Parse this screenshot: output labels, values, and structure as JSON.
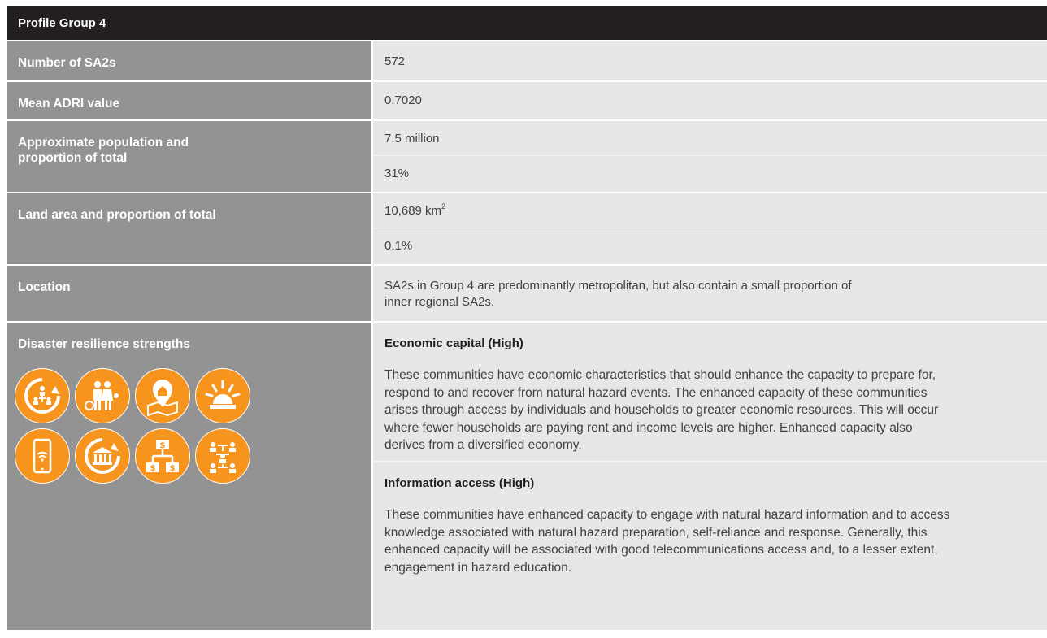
{
  "header": {
    "title": "Profile Group 4"
  },
  "rows": {
    "sa2": {
      "label": "Number of SA2s",
      "value": "572"
    },
    "adri": {
      "label": "Mean ADRI value",
      "value": "0.7020"
    },
    "population": {
      "label": "Approximate population and proportion of total",
      "value1": "7.5 million",
      "value2": "31%"
    },
    "land": {
      "label": "Land area and proportion of total",
      "value1": "10,689 km",
      "value1_sup": "2",
      "value2": "0.1%"
    },
    "location": {
      "label": "Location",
      "value": "SA2s in Group 4 are predominantly metropolitan, but also contain a small proportion of inner regional SA2s."
    },
    "strengths": {
      "label": "Disaster resilience strengths",
      "icons": [
        "social-network-cycle-icon",
        "family-group-icon",
        "home-location-map-icon",
        "warning-light-icon",
        "mobile-phone-wifi-icon",
        "institution-cycle-icon",
        "money-flow-chart-icon",
        "community-network-icon"
      ],
      "items": [
        {
          "title": "Economic capital (High)",
          "text": "These communities have economic characteristics that should enhance the capacity to prepare for, respond to and recover from natural hazard events. The enhanced capacity of these communities arises through access by individuals and households to greater economic resources. This will occur where fewer households are paying rent and income levels are higher. Enhanced capacity also derives from a diversified economy."
        },
        {
          "title": "Information access (High)",
          "text": "These communities have enhanced capacity to engage with natural hazard information and to access knowledge associated with natural hazard preparation, self-reliance and response. Generally, this enhanced capacity will be associated with good telecommunications access and, to a lesser extent, engagement in hazard education."
        }
      ]
    }
  },
  "colors": {
    "header_bg": "#231f20",
    "label_bg": "#939393",
    "value_bg": "#e6e7e8",
    "icon_orange": "#f7941d"
  }
}
